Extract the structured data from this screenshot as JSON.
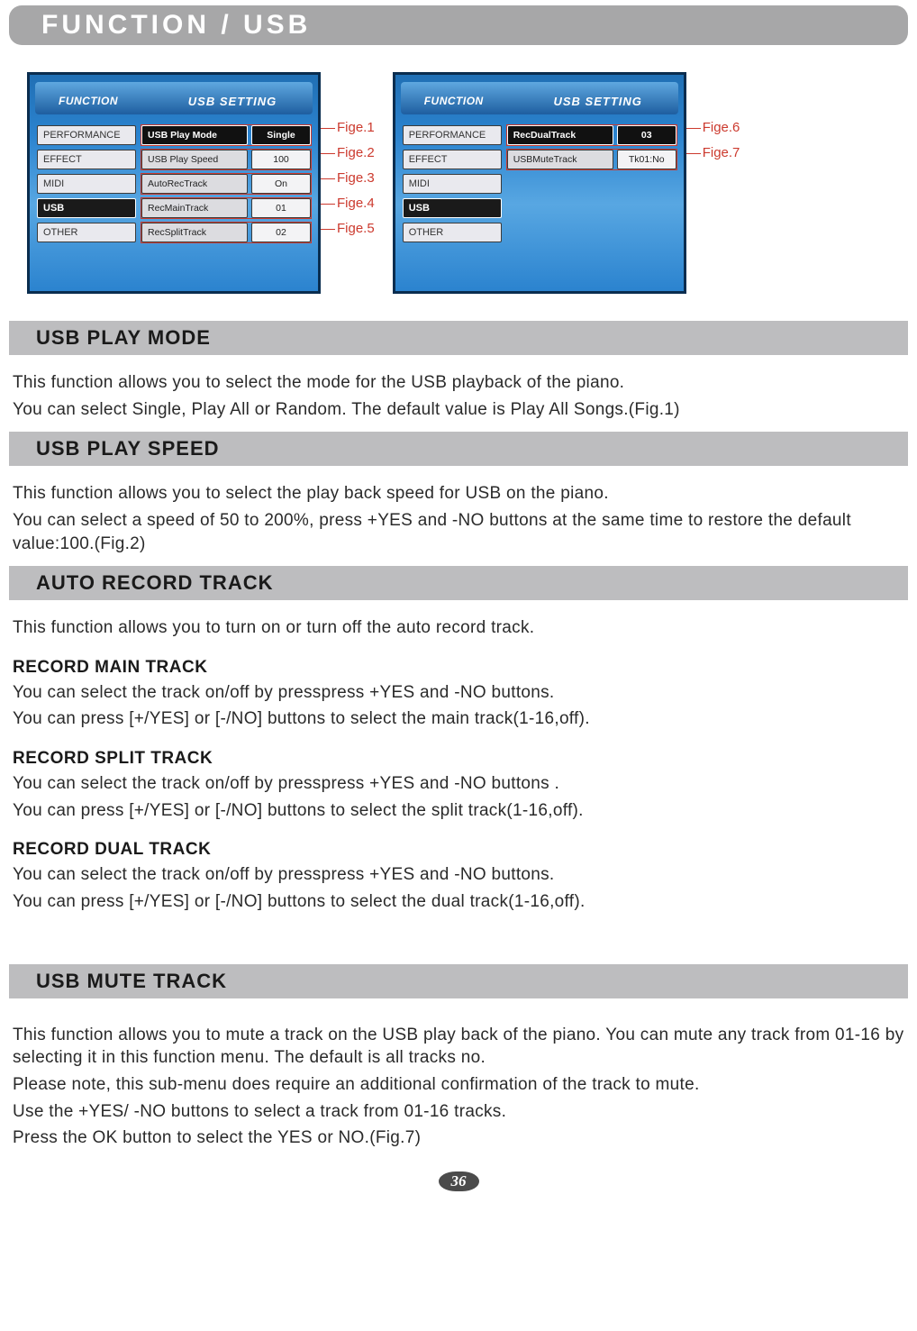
{
  "header": {
    "title": "FUNCTION / USB"
  },
  "screens": {
    "head_left": "FUNCTION",
    "head_right": "USB SETTING",
    "sidebar": {
      "items": [
        "PERFORMANCE",
        "EFFECT",
        "MIDI",
        "USB",
        "OTHER"
      ],
      "active_index": 3
    },
    "left_table": {
      "rows": [
        {
          "label": "USB Play Mode",
          "value": "Single",
          "label_active": true,
          "value_active": true
        },
        {
          "label": "USB Play Speed",
          "value": "100"
        },
        {
          "label": "AutoRecTrack",
          "value": "On"
        },
        {
          "label": "RecMainTrack",
          "value": "01"
        },
        {
          "label": "RecSplitTrack",
          "value": "02"
        }
      ],
      "fig_labels": [
        "Fige.1",
        "Fige.2",
        "Fige.3",
        "Fige.4",
        "Fige.5"
      ]
    },
    "right_table": {
      "rows": [
        {
          "label": "RecDualTrack",
          "value": "03",
          "label_active": true,
          "value_active": true
        },
        {
          "label": "USBMuteTrack",
          "value": "Tk01:No"
        }
      ],
      "fig_labels": [
        "Fige.6",
        "Fige.7"
      ]
    }
  },
  "sections": [
    {
      "heading": "USB PLAY MODE",
      "paragraphs": [
        "This function allows you to select the mode for the USB playback of the piano.",
        "You can select Single, Play All or Random. The default value is Play All Songs.(Fig.1)"
      ]
    },
    {
      "heading": "USB PLAY SPEED",
      "paragraphs": [
        "This function allows you to select the play back speed for USB on the piano.",
        "You can select a speed of 50 to 200%, press +YES and -NO buttons at the same time to restore the default value:100.(Fig.2)"
      ]
    },
    {
      "heading": "AUTO RECORD TRACK",
      "paragraphs": [
        "This function allows you to turn on or turn off the auto record track."
      ],
      "subsections": [
        {
          "subheading": "RECORD MAIN TRACK",
          "paragraphs": [
            "You can select the track on/off by presspress +YES and -NO buttons.",
            "You can press [+/YES] or [-/NO] buttons to select the main track(1-16,off)."
          ]
        },
        {
          "subheading": "RECORD SPLIT TRACK",
          "paragraphs": [
            "You can select the track on/off by presspress +YES and -NO buttons .",
            "You can press [+/YES] or [-/NO] buttons to select the split track(1-16,off)."
          ]
        },
        {
          "subheading": "RECORD DUAL TRACK",
          "paragraphs": [
            "You can select the track on/off by presspress +YES and -NO buttons.",
            "You can press [+/YES] or [-/NO] buttons to select the dual track(1-16,off)."
          ]
        }
      ]
    },
    {
      "heading": "USB MUTE TRACK",
      "paragraphs": [
        "This function allows you to mute a track on the USB play back of the piano. You can mute any track from 01-16 by selecting it in this function menu. The default is all tracks no.",
        "Please note, this sub-menu does require an additional confirmation of the track to mute.",
        "Use the +YES/ -NO buttons to select a track from 01-16 tracks.",
        "Press the OK button to select the YES or NO.(Fig.7)"
      ]
    }
  ],
  "page_number": "36"
}
